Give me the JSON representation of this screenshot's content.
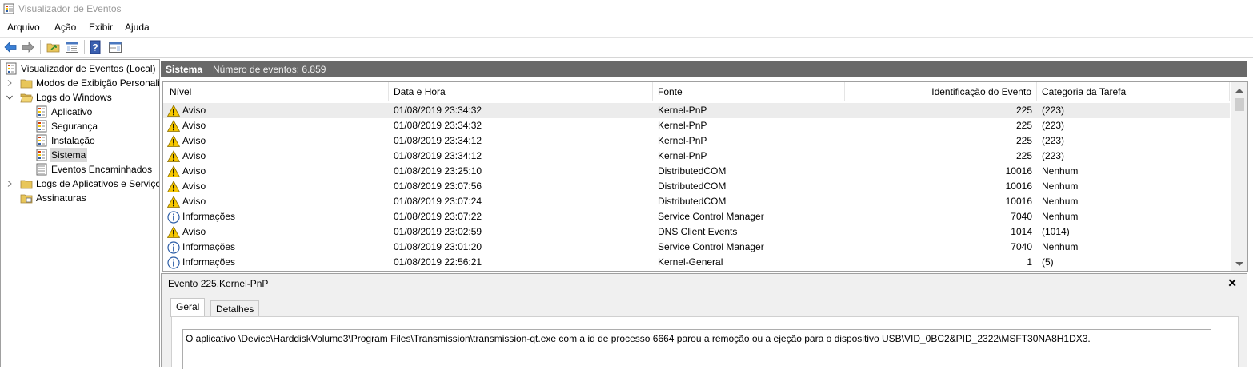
{
  "window": {
    "title": "Visualizador de Eventos"
  },
  "menu": [
    "Arquivo",
    "Ação",
    "Exibir",
    "Ajuda"
  ],
  "tree": {
    "root": "Visualizador de Eventos (Local)",
    "custom_views": "Modos de Exibição Personali",
    "windows_logs": "Logs do Windows",
    "application": "Aplicativo",
    "security": "Segurança",
    "setup": "Instalação",
    "system": "Sistema",
    "forwarded": "Eventos Encaminhados",
    "app_services": "Logs de Aplicativos e Serviço",
    "subscriptions": "Assinaturas"
  },
  "header": {
    "log_name": "Sistema",
    "count": "Número de eventos: 6.859"
  },
  "columns": {
    "level": "Nível",
    "date": "Data e Hora",
    "source": "Fonte",
    "event_id": "Identificação do Evento",
    "category": "Categoria da Tarefa"
  },
  "events": [
    {
      "level": "Aviso",
      "type": "warning",
      "date": "01/08/2019 23:34:32",
      "source": "Kernel-PnP",
      "id": "225",
      "category": "(223)"
    },
    {
      "level": "Aviso",
      "type": "warning",
      "date": "01/08/2019 23:34:32",
      "source": "Kernel-PnP",
      "id": "225",
      "category": "(223)"
    },
    {
      "level": "Aviso",
      "type": "warning",
      "date": "01/08/2019 23:34:12",
      "source": "Kernel-PnP",
      "id": "225",
      "category": "(223)"
    },
    {
      "level": "Aviso",
      "type": "warning",
      "date": "01/08/2019 23:34:12",
      "source": "Kernel-PnP",
      "id": "225",
      "category": "(223)"
    },
    {
      "level": "Aviso",
      "type": "warning",
      "date": "01/08/2019 23:25:10",
      "source": "DistributedCOM",
      "id": "10016",
      "category": "Nenhum"
    },
    {
      "level": "Aviso",
      "type": "warning",
      "date": "01/08/2019 23:07:56",
      "source": "DistributedCOM",
      "id": "10016",
      "category": "Nenhum"
    },
    {
      "level": "Aviso",
      "type": "warning",
      "date": "01/08/2019 23:07:24",
      "source": "DistributedCOM",
      "id": "10016",
      "category": "Nenhum"
    },
    {
      "level": "Informações",
      "type": "info",
      "date": "01/08/2019 23:07:22",
      "source": "Service Control Manager",
      "id": "7040",
      "category": "Nenhum"
    },
    {
      "level": "Aviso",
      "type": "warning",
      "date": "01/08/2019 23:02:59",
      "source": "DNS Client Events",
      "id": "1014",
      "category": "(1014)"
    },
    {
      "level": "Informações",
      "type": "info",
      "date": "01/08/2019 23:01:20",
      "source": "Service Control Manager",
      "id": "7040",
      "category": "Nenhum"
    },
    {
      "level": "Informações",
      "type": "info",
      "date": "01/08/2019 22:56:21",
      "source": "Kernel-General",
      "id": "1",
      "category": "(5)"
    }
  ],
  "details": {
    "title": "Evento 225,Kernel-PnP",
    "tab_general": "Geral",
    "tab_details": "Detalhes",
    "description": "O aplicativo \\Device\\HarddiskVolume3\\Program Files\\Transmission\\transmission-qt.exe com a id de processo 6664 parou a remoção ou a ejeção para o dispositivo USB\\VID_0BC2&PID_2322\\MSFT30NA8H1DX3."
  },
  "colors": {
    "header_bg": "#696969",
    "selected_row": "#ececec",
    "warning": "#f6c700",
    "info": "#2e5fa8"
  }
}
